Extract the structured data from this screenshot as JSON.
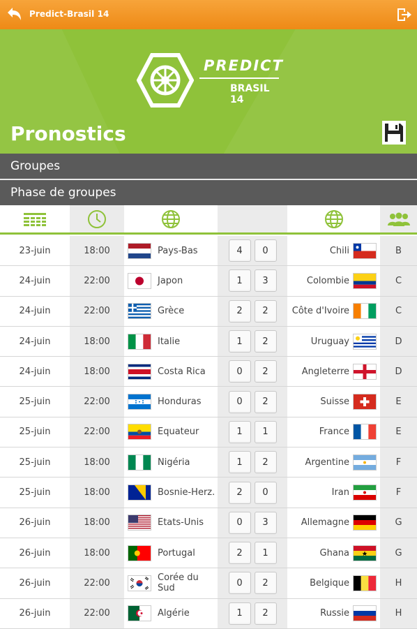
{
  "app": {
    "title": "Predict-Brasil 14"
  },
  "logo": {
    "line1": "PREDICT",
    "line2": "BRASIL 14"
  },
  "page": {
    "title": "Pronostics"
  },
  "sections": {
    "groups": "Groupes",
    "phase": "Phase de groupes"
  },
  "header_icons": [
    "calendar-icon",
    "clock-icon",
    "globe-icon",
    "globe-icon",
    "users-icon"
  ],
  "colors": {
    "accent_orange": "#f0901c",
    "accent_green": "#8fc23a",
    "section_gray": "#5a5a5a"
  },
  "matches": [
    {
      "date": "23-juin",
      "time": "18:00",
      "home": "Pays-Bas",
      "home_flag": "nl",
      "score_home": "4",
      "score_away": "0",
      "away": "Chili",
      "away_flag": "cl",
      "group": "B"
    },
    {
      "date": "24-juin",
      "time": "22:00",
      "home": "Japon",
      "home_flag": "jp",
      "score_home": "1",
      "score_away": "3",
      "away": "Colombie",
      "away_flag": "co",
      "group": "C"
    },
    {
      "date": "24-juin",
      "time": "22:00",
      "home": "Grèce",
      "home_flag": "gr",
      "score_home": "2",
      "score_away": "2",
      "away": "Côte d'Ivoire",
      "away_flag": "ci",
      "group": "C"
    },
    {
      "date": "24-juin",
      "time": "18:00",
      "home": "Italie",
      "home_flag": "it",
      "score_home": "1",
      "score_away": "2",
      "away": "Uruguay",
      "away_flag": "uy",
      "group": "D"
    },
    {
      "date": "24-juin",
      "time": "18:00",
      "home": "Costa Rica",
      "home_flag": "cr",
      "score_home": "0",
      "score_away": "2",
      "away": "Angleterre",
      "away_flag": "en",
      "group": "D"
    },
    {
      "date": "25-juin",
      "time": "22:00",
      "home": "Honduras",
      "home_flag": "hn",
      "score_home": "0",
      "score_away": "2",
      "away": "Suisse",
      "away_flag": "ch",
      "group": "E"
    },
    {
      "date": "25-juin",
      "time": "22:00",
      "home": "Equateur",
      "home_flag": "ec",
      "score_home": "1",
      "score_away": "1",
      "away": "France",
      "away_flag": "fr",
      "group": "E"
    },
    {
      "date": "25-juin",
      "time": "18:00",
      "home": "Nigéria",
      "home_flag": "ng",
      "score_home": "1",
      "score_away": "2",
      "away": "Argentine",
      "away_flag": "ar",
      "group": "F"
    },
    {
      "date": "25-juin",
      "time": "18:00",
      "home": "Bosnie-Herz.",
      "home_flag": "ba",
      "score_home": "2",
      "score_away": "0",
      "away": "Iran",
      "away_flag": "ir",
      "group": "F"
    },
    {
      "date": "26-juin",
      "time": "18:00",
      "home": "Etats-Unis",
      "home_flag": "us",
      "score_home": "0",
      "score_away": "3",
      "away": "Allemagne",
      "away_flag": "de",
      "group": "G"
    },
    {
      "date": "26-juin",
      "time": "18:00",
      "home": "Portugal",
      "home_flag": "pt",
      "score_home": "2",
      "score_away": "1",
      "away": "Ghana",
      "away_flag": "gh",
      "group": "G"
    },
    {
      "date": "26-juin",
      "time": "22:00",
      "home": "Corée du Sud",
      "home_flag": "kr",
      "score_home": "0",
      "score_away": "2",
      "away": "Belgique",
      "away_flag": "be",
      "group": "H"
    },
    {
      "date": "26-juin",
      "time": "22:00",
      "home": "Algérie",
      "home_flag": "dz",
      "score_home": "1",
      "score_away": "2",
      "away": "Russie",
      "away_flag": "ru",
      "group": "H"
    }
  ]
}
